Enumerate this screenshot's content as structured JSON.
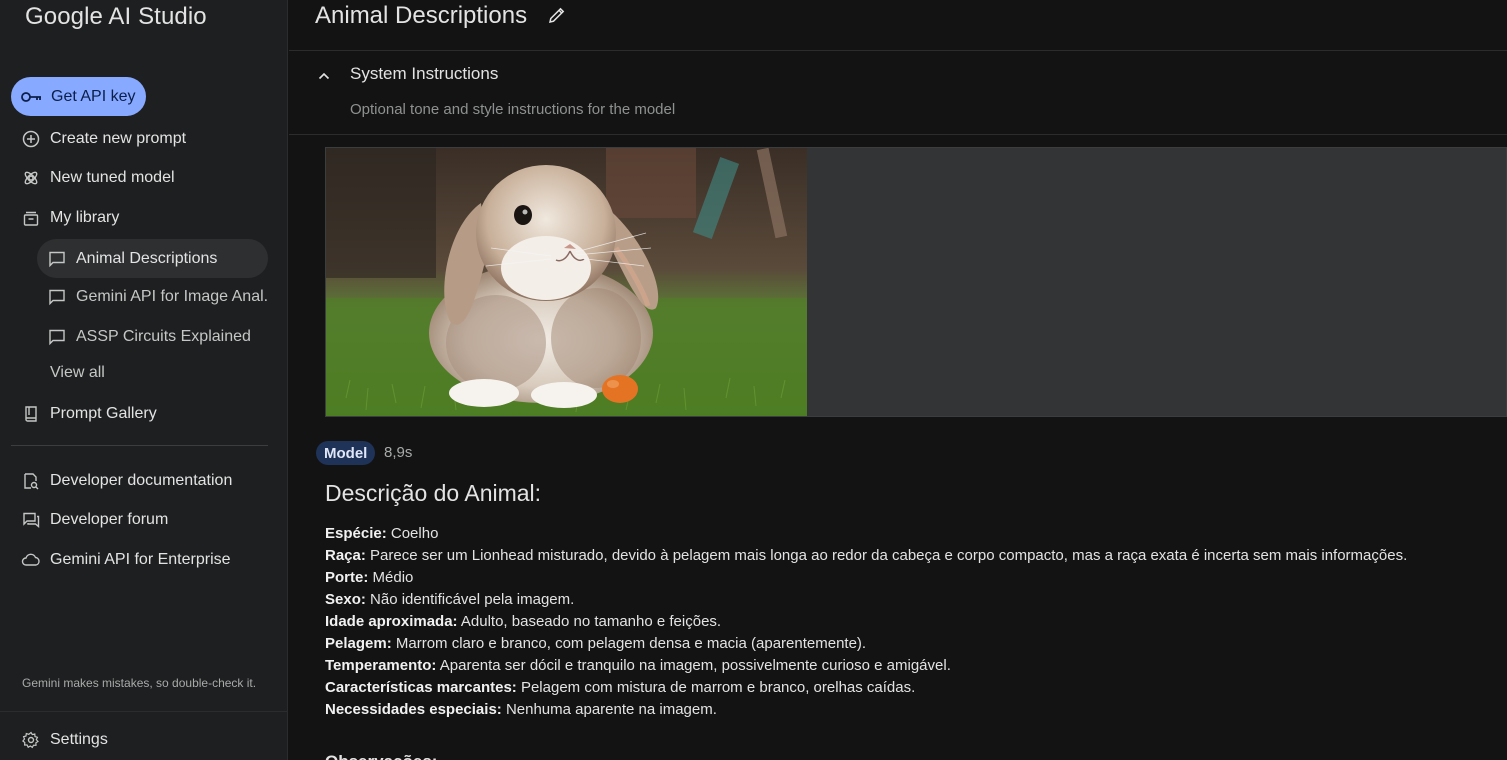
{
  "app": {
    "title": "Google AI Studio"
  },
  "sidebar": {
    "api_key_label": "Get API key",
    "nav": [
      {
        "label": "Create new prompt",
        "icon": "plus-circle-icon"
      },
      {
        "label": "New tuned model",
        "icon": "tuned-model-icon"
      },
      {
        "label": "My library",
        "icon": "library-icon"
      }
    ],
    "library_items": [
      {
        "label": "Animal Descriptions",
        "icon": "chat-icon",
        "active": true
      },
      {
        "label": "Gemini API for Image Anal...",
        "icon": "chat-icon",
        "active": false
      },
      {
        "label": "ASSP Circuits Explained",
        "icon": "chat-icon",
        "active": false
      }
    ],
    "view_all": "View all",
    "prompt_gallery": "Prompt Gallery",
    "resources": [
      {
        "label": "Developer documentation",
        "icon": "doc-search-icon"
      },
      {
        "label": "Developer forum",
        "icon": "forum-icon"
      },
      {
        "label": "Gemini API for Enterprise",
        "icon": "cloud-icon"
      }
    ],
    "disclaimer": "Gemini makes mistakes, so double-check it.",
    "settings": "Settings"
  },
  "header": {
    "title": "Animal Descriptions"
  },
  "system_instructions": {
    "title": "System Instructions",
    "placeholder": "Optional tone and style instructions for the model"
  },
  "response": {
    "badge": "Model",
    "time": "8,9s",
    "heading": "Descrição do Animal:",
    "fields": [
      {
        "label": "Espécie:",
        "value": " Coelho"
      },
      {
        "label": "Raça:",
        "value": " Parece ser um Lionhead misturado, devido à pelagem mais longa ao redor da cabeça e corpo compacto, mas a raça exata é incerta sem mais informações."
      },
      {
        "label": "Porte:",
        "value": " Médio"
      },
      {
        "label": "Sexo:",
        "value": " Não identificável pela imagem."
      },
      {
        "label": "Idade aproximada:",
        "value": " Adulto, baseado no tamanho e feições."
      },
      {
        "label": "Pelagem:",
        "value": " Marrom claro e branco, com pelagem densa e macia (aparentemente)."
      },
      {
        "label": "Temperamento:",
        "value": " Aparenta ser dócil e tranquilo na imagem, possivelmente curioso e amigável."
      },
      {
        "label": "Características marcantes:",
        "value": " Pelagem com mistura de marrom e branco, orelhas caídas."
      },
      {
        "label": "Necessidades especiais:",
        "value": " Nenhuma aparente na imagem."
      }
    ],
    "next_heading": "Observações:"
  },
  "colors": {
    "background": "#131314",
    "sidebar": "#1e1f20",
    "accent": "#87a9ff",
    "badge": "#1f3257"
  }
}
